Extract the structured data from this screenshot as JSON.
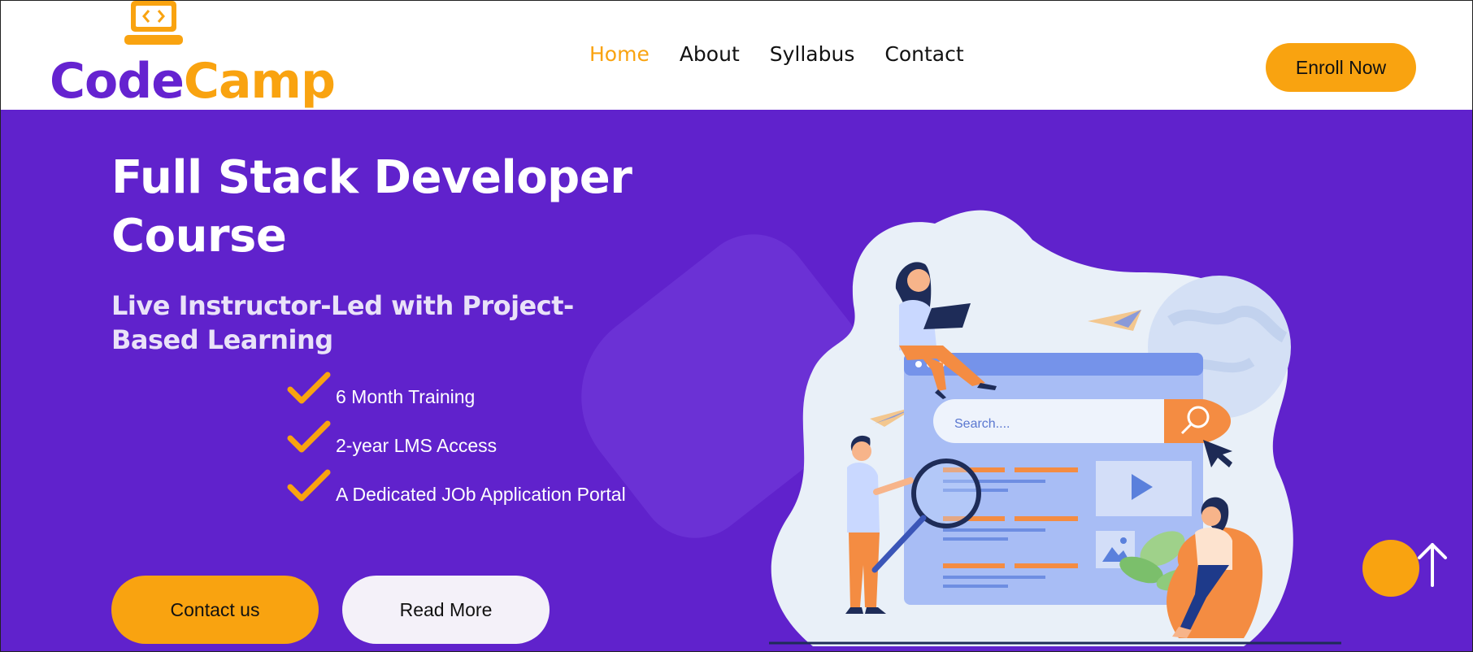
{
  "brand": {
    "name_part1": "Code",
    "name_part2": "Camp",
    "icon": "laptop-code-icon",
    "color_primary": "#6523d0",
    "color_accent": "#f9a310"
  },
  "nav": {
    "items": [
      {
        "label": "Home",
        "active": true
      },
      {
        "label": "About",
        "active": false
      },
      {
        "label": "Syllabus",
        "active": false
      },
      {
        "label": "Contact",
        "active": false
      }
    ],
    "enroll_label": "Enroll Now"
  },
  "hero": {
    "title": "Full Stack Developer Course",
    "subtitle": "Live Instructor-Led with Project-Based Learning",
    "features": [
      {
        "icon": "check-icon",
        "text": "6 Month Training"
      },
      {
        "icon": "check-icon",
        "text": "2-year LMS Access"
      },
      {
        "icon": "check-icon",
        "text": "A Dedicated JOb Application Portal"
      }
    ],
    "contact_label": "Contact us",
    "read_more_label": "Read More",
    "background_color": "#6022cc"
  },
  "illustration": {
    "search_placeholder": "Search....",
    "icons": [
      "search-icon",
      "play-icon",
      "image-icon",
      "globe-icon",
      "paper-plane-icon",
      "magnifier-icon",
      "cursor-icon"
    ]
  },
  "scroll_top": {
    "icon": "arrow-up-icon"
  }
}
